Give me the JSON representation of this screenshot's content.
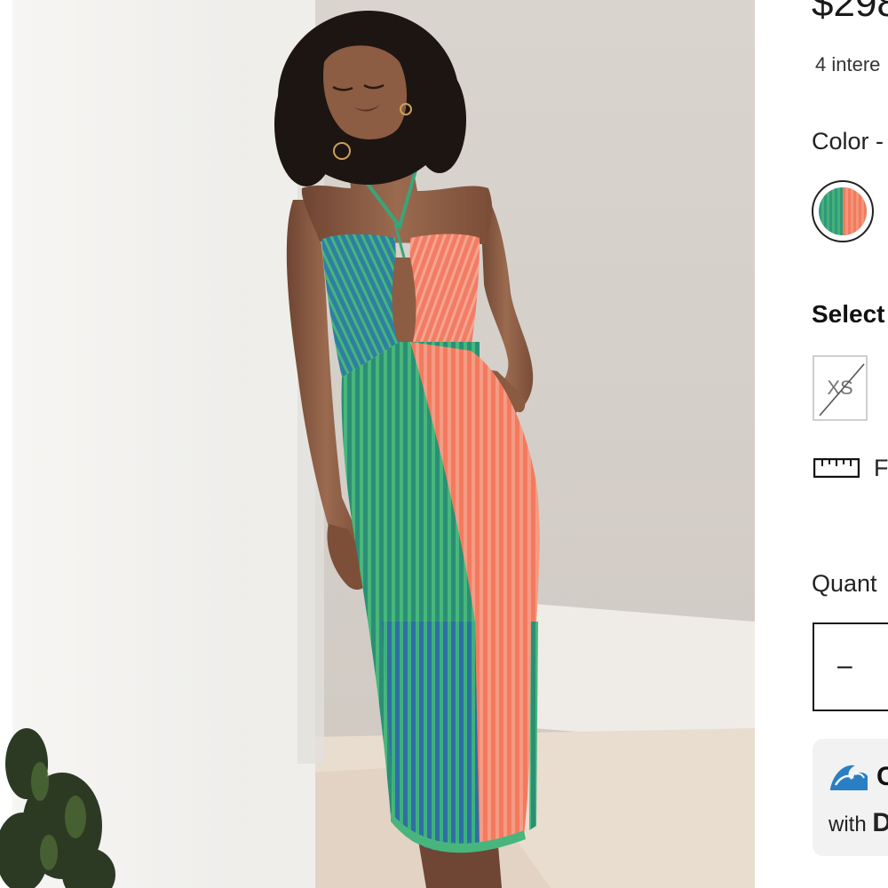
{
  "product": {
    "price_partial": "$298",
    "interest_partial": "4 intere",
    "color_label_partial": "Color -",
    "color_swatch": {
      "colors": [
        "#2f9a78",
        "#f47a5e"
      ],
      "selected": true
    },
    "size_label_partial": "Select",
    "sizes": [
      {
        "label": "XS",
        "available": false
      }
    ],
    "fit_guide_partial": "F",
    "quantity_label_partial": "Quant",
    "quantity_minus": "–",
    "promo": {
      "line1_partial": "C",
      "line2_prefix": "with",
      "line2_bold_partial": "D"
    }
  },
  "photo": {
    "alt": "product-photo",
    "palette": {
      "wall": "#f6f5f3",
      "backdrop": "#d8d3cd",
      "floor": "#e9ddd0",
      "green": "#2f9a78",
      "coral": "#f47a5e",
      "skin": "#8a5a41",
      "hair": "#1d1511"
    }
  },
  "icons": {
    "ruler": "ruler-icon",
    "wave": "wave-icon"
  }
}
